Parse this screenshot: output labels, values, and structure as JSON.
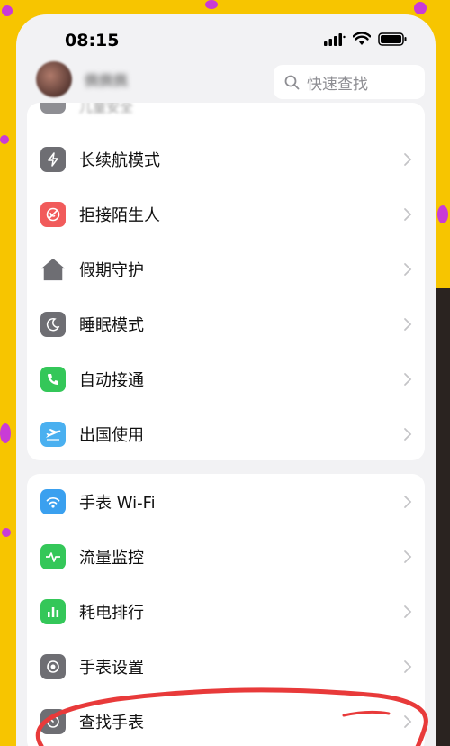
{
  "status_bar": {
    "time": "08:15"
  },
  "header": {
    "search_placeholder": "快速查找",
    "profile_name": "佩佩佩"
  },
  "card1": {
    "partial_item": "儿童安全",
    "items": [
      {
        "label": "长续航模式",
        "icon": "bolt-icon",
        "color": "#6e6e73"
      },
      {
        "label": "拒接陌生人",
        "icon": "block-phone-icon",
        "color": "#f15b5b"
      },
      {
        "label": "假期守护",
        "icon": "home-icon",
        "color": "#6e6e73"
      },
      {
        "label": "睡眠模式",
        "icon": "moon-icon",
        "color": "#6e6e73"
      },
      {
        "label": "自动接通",
        "icon": "phone-icon",
        "color": "#34c759"
      },
      {
        "label": "出国使用",
        "icon": "airplane-icon",
        "color": "#4ab0f0"
      }
    ]
  },
  "card2": {
    "items": [
      {
        "label": "手表 Wi-Fi",
        "icon": "wifi-icon",
        "color": "#3aa0ef"
      },
      {
        "label": "流量监控",
        "icon": "pulse-icon",
        "color": "#34c759"
      },
      {
        "label": "耗电排行",
        "icon": "bar-chart-icon",
        "color": "#34c759"
      },
      {
        "label": "手表设置",
        "icon": "watch-settings-icon",
        "color": "#6e6e73"
      },
      {
        "label": "查找手表",
        "icon": "find-watch-icon",
        "color": "#6e6e73"
      }
    ]
  }
}
